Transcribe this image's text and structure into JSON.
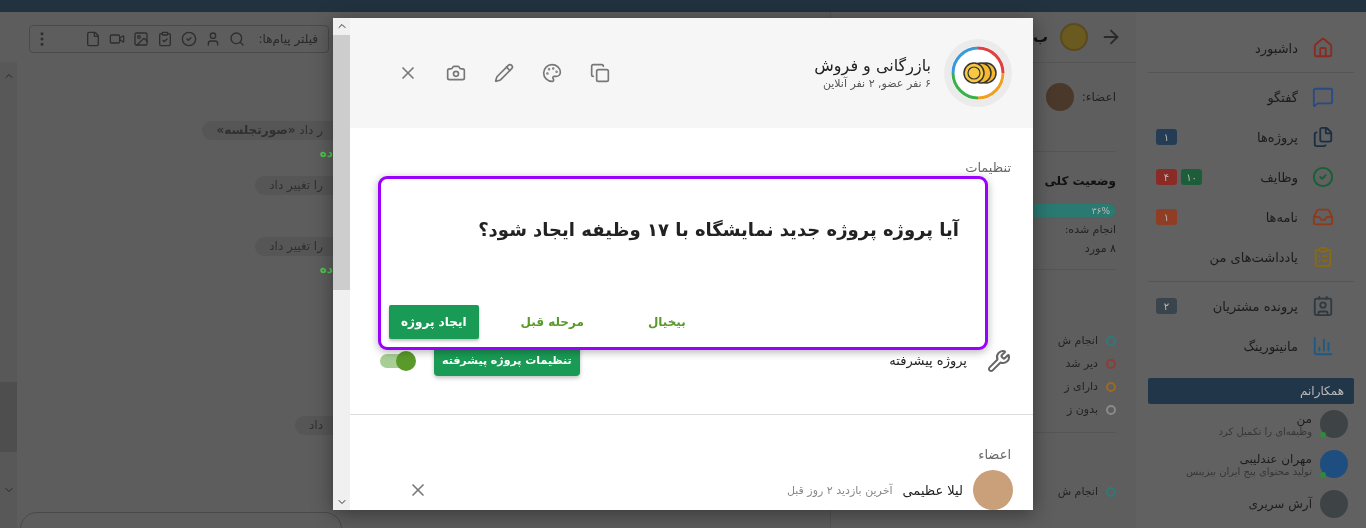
{
  "sidebar": {
    "groups": [
      [
        {
          "label": "داشبورد"
        }
      ],
      [
        {
          "label": "گفتگو"
        },
        {
          "label": "پروژه‌ها",
          "badges": [
            {
              "text": "۱",
              "color": "#243d55"
            }
          ]
        },
        {
          "label": "وظایف",
          "badges": [
            {
              "text": "۱۰",
              "color": "#1d5e3a"
            },
            {
              "text": "۴",
              "color": "#8a2b25"
            }
          ]
        },
        {
          "label": "نامه‌ها",
          "badges": [
            {
              "text": "۱",
              "color": "#8f3d25"
            }
          ]
        },
        {
          "label": "یادداشت‌های من"
        }
      ],
      [
        {
          "label": "پرونده مشتریان",
          "badges": [
            {
              "text": "۲",
              "color": "#3a444c"
            }
          ]
        },
        {
          "label": "مانیتورینگ"
        }
      ]
    ],
    "colleagues": {
      "title": "همکارانم",
      "people": [
        {
          "name": "من",
          "status": "وظیفه‌ای را تکمیل کرد",
          "online": true
        },
        {
          "name": "مهران عندلیبی",
          "status": "تولید محتوای پیج ایران بیزینس",
          "online": true
        },
        {
          "name": "آرش سریری",
          "online": false
        }
      ]
    }
  },
  "project_panel": {
    "title": "ب",
    "members_label": "اعضاء:",
    "status_title": "وضعیت کلی",
    "progress": {
      "level": 0.36,
      "reading": "۳۶%"
    },
    "done_label": "انجام شده:",
    "done_count": "۸ مورد",
    "legend": [
      {
        "label": "انجام ش",
        "color": "#2f7a78"
      },
      {
        "label": "دیر شد",
        "color": "#8f3c33"
      },
      {
        "label": "دارای ز",
        "color": "#9a6a22"
      },
      {
        "label": "بدون ز",
        "color": "#8a8a8a"
      }
    ],
    "legend_2": [
      {
        "label": "انجام ش",
        "color": "#2f7a78"
      }
    ]
  },
  "chat": {
    "filter_label": "فیلتر پیام‌ها:",
    "messages": [
      {
        "kind": "pill",
        "text": "ر داد **«صورتجلسه»**"
      },
      {
        "kind": "green",
        "text": "ده"
      },
      {
        "kind": "pill",
        "text": "را تغییر داد"
      },
      {
        "kind": "pill",
        "text": "را تغییر داد"
      },
      {
        "kind": "green",
        "text": "ده"
      },
      {
        "kind": "pill",
        "text": "داد"
      }
    ]
  },
  "modal": {
    "title": "بازرگانی و فروش",
    "subtitle": "۶ نفر عضو, ۲ نفر آنلاین",
    "settings_label": "تنظیمات",
    "advanced": {
      "label": "پروژه پیشرفته",
      "button": "تنظیمات پروژه پیشرفته",
      "on": true
    },
    "members_label": "اعضاء",
    "members": [
      {
        "name": "لیلا عظیمی",
        "last_seen": "آخرین بازدید ۲ روز قبل"
      }
    ]
  },
  "dialog": {
    "question": "آیا پروژه پروژه جدید نمایشگاه با ۱۷ وظیفه ایجاد شود؟",
    "buttons": [
      {
        "label": "بیخیال",
        "kind": "text"
      },
      {
        "label": "مرحله قبل",
        "kind": "text"
      },
      {
        "label": "ایجاد پروژه",
        "kind": "filled"
      }
    ]
  }
}
